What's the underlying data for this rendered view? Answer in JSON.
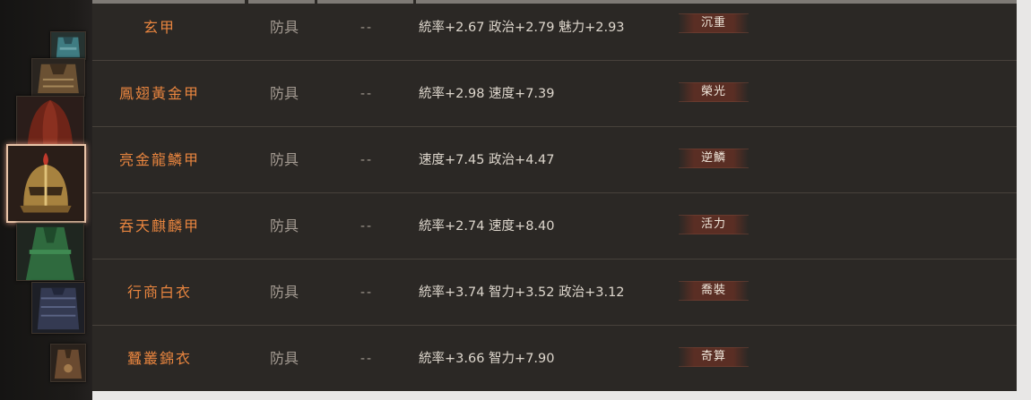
{
  "items": [
    {
      "name": "玄甲",
      "type": "防具",
      "grade": "--",
      "stats": "統率+2.67 政治+2.79 魅力+2.93",
      "skill": "沉重"
    },
    {
      "name": "鳳翅黃金甲",
      "type": "防具",
      "grade": "--",
      "stats": "統率+2.98 速度+7.39",
      "skill": "榮光"
    },
    {
      "name": "亮金龍鱗甲",
      "type": "防具",
      "grade": "--",
      "stats": "速度+7.45 政治+4.47",
      "skill": "逆鱗"
    },
    {
      "name": "吞天麒麟甲",
      "type": "防具",
      "grade": "--",
      "stats": "統率+2.74 速度+8.40",
      "skill": "活力"
    },
    {
      "name": "行商白衣",
      "type": "防具",
      "grade": "--",
      "stats": "統率+3.74 智力+3.52 政治+3.12",
      "skill": "喬裝"
    },
    {
      "name": "蠶叢錦衣",
      "type": "防具",
      "grade": "--",
      "stats": "統率+3.66 智力+7.90",
      "skill": "奇算"
    }
  ],
  "thumbnails": [
    {
      "icon": "teal-armor-icon"
    },
    {
      "icon": "bronze-armor-icon"
    },
    {
      "icon": "red-cloak-icon"
    },
    {
      "icon": "golden-helmet-icon",
      "selected": true
    },
    {
      "icon": "green-robe-icon"
    },
    {
      "icon": "dark-lamellar-icon"
    },
    {
      "icon": "brocade-robe-icon"
    }
  ],
  "colors": {
    "name": "#e8853f",
    "type": "#a49b92",
    "stats": "#ded7cd",
    "skill_bg": "#5a2e24",
    "panel_bg": "#2b2825",
    "selected_border": "#e9c4a8"
  }
}
